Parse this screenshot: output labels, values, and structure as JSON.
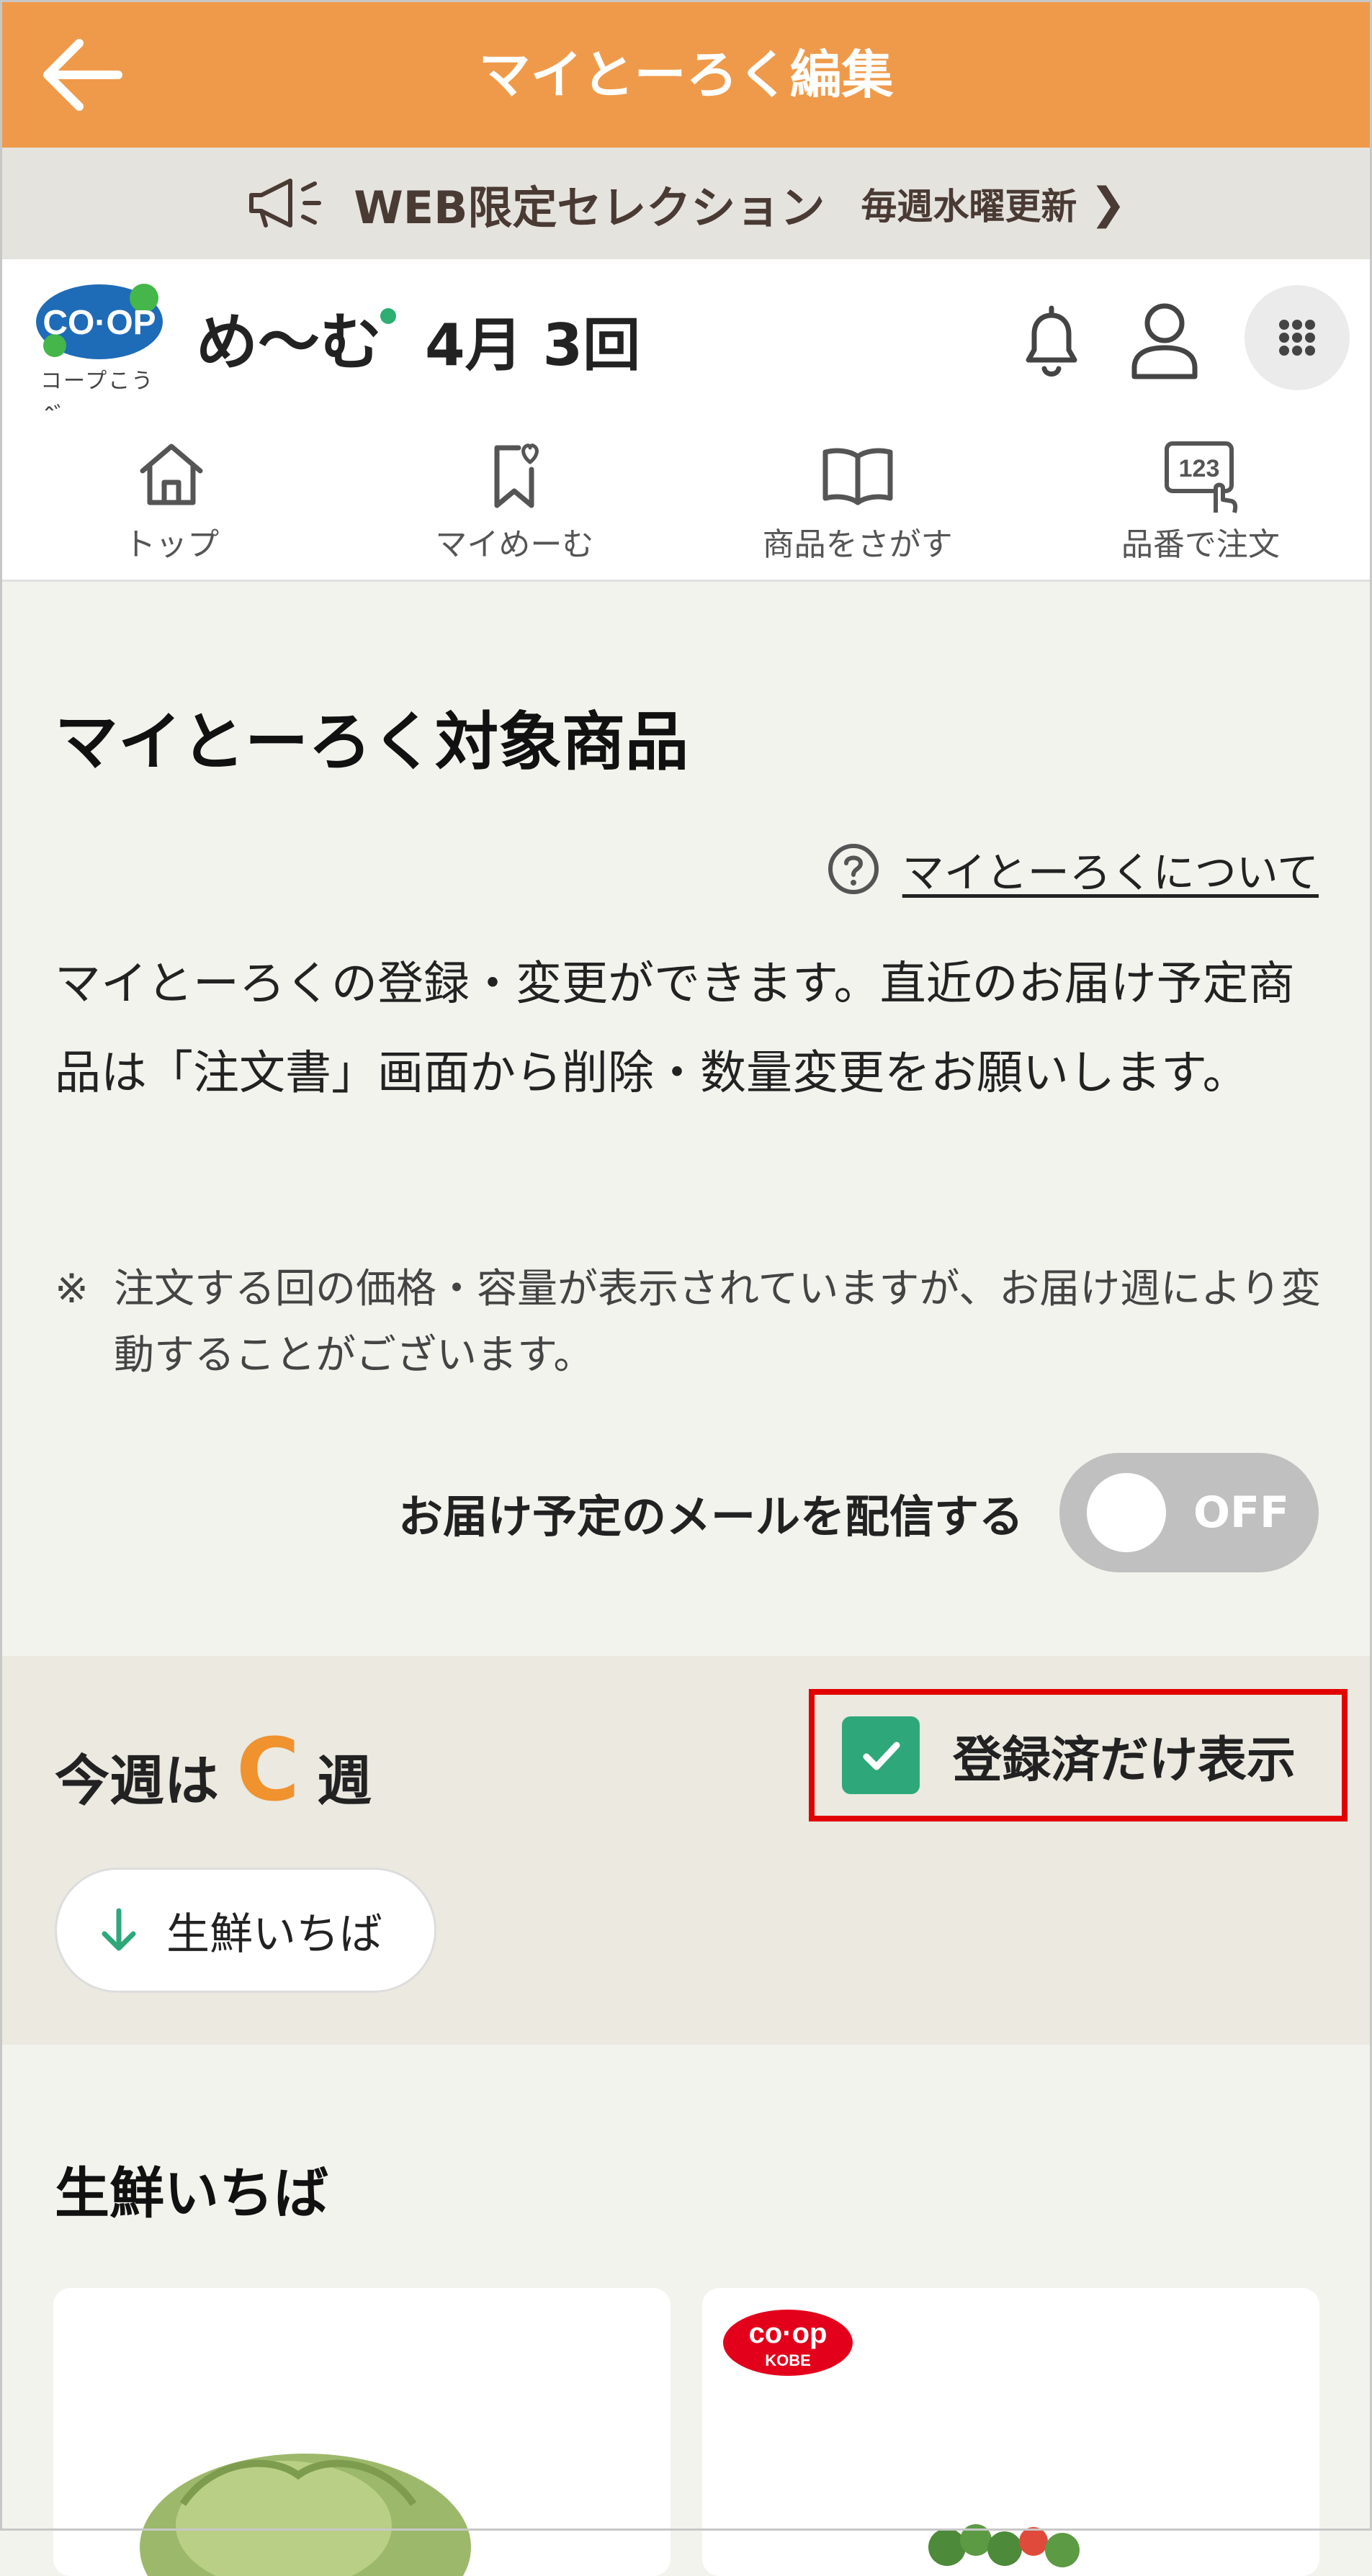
{
  "header": {
    "title": "マイとーろく編集",
    "back_icon": "arrow-left-icon",
    "bg_color": "#ef9a4a"
  },
  "promo": {
    "title": "WEB限定セレクション",
    "subtitle": "毎週水曜更新",
    "chevron": "❯"
  },
  "brand": {
    "logo_text": "CO·OP",
    "logo_subtext": "コープこうべ",
    "service_name": "め〜む",
    "delivery_round": "4月 3回"
  },
  "nav": {
    "items": [
      {
        "label": "トップ",
        "icon": "home-icon"
      },
      {
        "label": "マイめーむ",
        "icon": "bookmark-heart-icon"
      },
      {
        "label": "商品をさがす",
        "icon": "book-icon"
      },
      {
        "label": "品番で注文",
        "icon": "number-tap-icon",
        "icon_text": "123"
      }
    ]
  },
  "content": {
    "heading": "マイとーろく対象商品",
    "about_link": "マイとーろくについて",
    "description": "マイとーろくの登録・変更ができます。直近のお届け予定商品は「注文書」画面から削除・数量変更をお願いします。",
    "note_mark": "※",
    "note": "注文する回の価格・容量が表示されていますが、お届け週により変動することがございます。",
    "mail_label": "お届け予定のメールを配信する",
    "mail_toggle": "OFF"
  },
  "week": {
    "prefix": "今週は",
    "letter": "C",
    "suffix": "週",
    "registered_only_label": "登録済だけ表示",
    "registered_only_checked": true,
    "jump_pill": "生鮮いちば"
  },
  "products": {
    "section_title": "生鮮いちば",
    "badge_line1": "co·op",
    "badge_line2": "KOBE"
  },
  "colors": {
    "accent": "#ef9a4a",
    "green": "#2ea87a",
    "week_letter": "#f0922e",
    "highlight_border": "#e30000"
  }
}
